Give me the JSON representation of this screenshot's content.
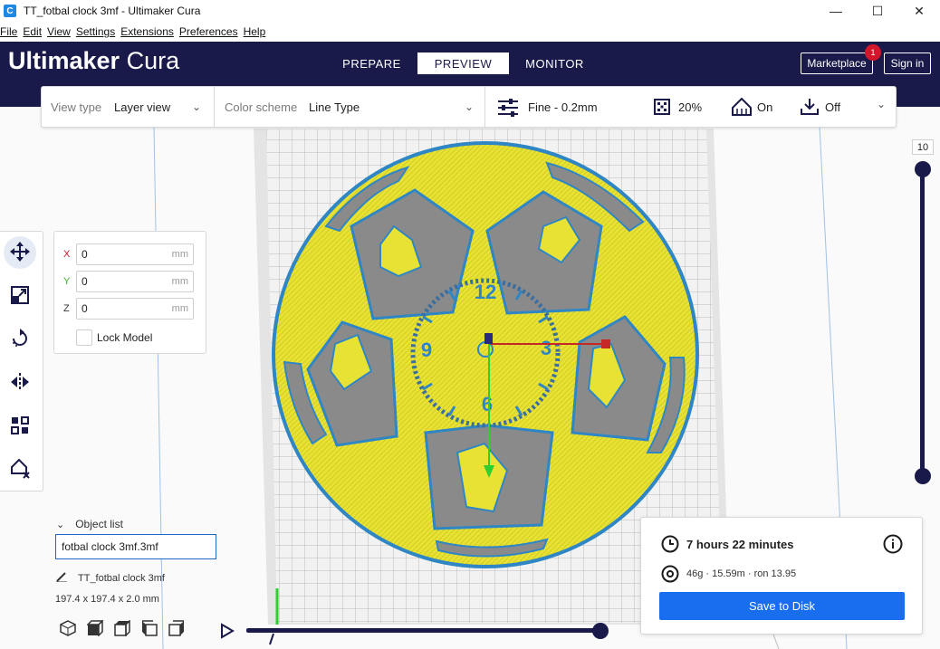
{
  "window": {
    "title": "TT_fotbal clock 3mf - Ultimaker Cura",
    "app_icon": "C",
    "controls": {
      "minimize": "—",
      "maximize": "☐",
      "close": "✕"
    }
  },
  "menu": [
    "File",
    "Edit",
    "View",
    "Settings",
    "Extensions",
    "Preferences",
    "Help"
  ],
  "header": {
    "brand_bold": "Ultimaker",
    "brand_light": " Cura",
    "stages": [
      "PREPARE",
      "PREVIEW",
      "MONITOR"
    ],
    "active_stage": "PREVIEW",
    "marketplace_label": "Marketplace",
    "marketplace_badge": "1",
    "signin_label": "Sign in",
    "colors": {
      "header_bg": "#1a1a4a",
      "accent_blue": "#196ef0",
      "badge_red": "#d3162b"
    }
  },
  "view_bar": {
    "view_type_label": "View type",
    "view_type_value": "Layer view",
    "color_scheme_label": "Color scheme",
    "color_scheme_value": "Line Type",
    "profile": "Fine - 0.2mm",
    "infill": "20%",
    "support": "On",
    "adhesion": "Off"
  },
  "left_tools": [
    "move-icon",
    "scale-icon",
    "rotate-icon",
    "mirror-icon",
    "per-model-settings-icon",
    "support-blocker-icon"
  ],
  "translate_panel": {
    "x_label": "X",
    "x_value": "0",
    "y_label": "Y",
    "y_value": "0",
    "z_label": "Z",
    "z_value": "0",
    "unit": "mm",
    "lock_label": "Lock Model",
    "axis_colors": {
      "x": "#d3162b",
      "y": "#3fae2a",
      "z": "#333333"
    }
  },
  "object_list": {
    "header": "Object list",
    "selected": "fotbal clock 3mf.3mf",
    "object_name": "TT_fotbal clock 3mf",
    "dimensions": "197.4 x 197.4 x 2.0 mm"
  },
  "layer_slider": {
    "top_label": "10"
  },
  "print_info": {
    "time": "7 hours 22 minutes",
    "material": "46g · 15.59m · ron 13.95",
    "save_label": "Save to Disk"
  },
  "model_colors": {
    "infill_yellow": "#e8e234",
    "wall_blue": "#2f86c4",
    "plate_gray": "#8a8a8a"
  },
  "dial_numerals": [
    "12",
    "3",
    "6",
    "9"
  ]
}
